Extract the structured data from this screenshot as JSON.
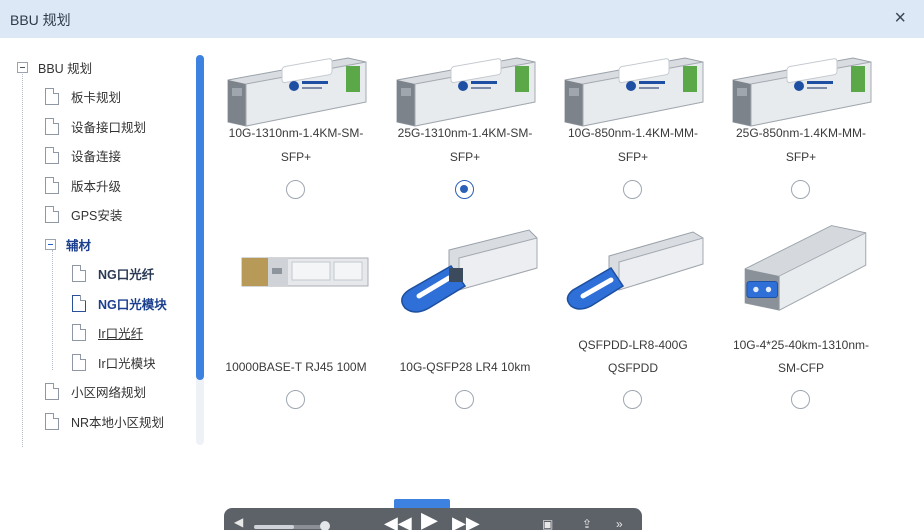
{
  "window": {
    "title": "BBU 规划",
    "close_glyph": "×"
  },
  "tree": {
    "root": "BBU 规划",
    "items": [
      {
        "label": "板卡规划"
      },
      {
        "label": "设备接口规划"
      },
      {
        "label": "设备连接"
      },
      {
        "label": "版本升级"
      },
      {
        "label": "GPS安装"
      }
    ],
    "group": {
      "label": "辅材",
      "children": [
        {
          "label": "NG口光纤"
        },
        {
          "label": "NG口光模块"
        },
        {
          "label": "Ir口光纤"
        },
        {
          "label": "Ir口光模块"
        }
      ]
    },
    "after": [
      {
        "label": "小区网络规划"
      },
      {
        "label": "NR本地小区规划"
      }
    ]
  },
  "modules": [
    {
      "line1": "10G-1310nm-1.4KM-SM-",
      "line2": "SFP+",
      "selected": false,
      "icon": "sfp-module-icon"
    },
    {
      "line1": "25G-1310nm-1.4KM-SM-",
      "line2": "SFP+",
      "selected": true,
      "icon": "sfp-module-icon"
    },
    {
      "line1": "10G-850nm-1.4KM-MM-",
      "line2": "SFP+",
      "selected": false,
      "icon": "sfp-module-icon"
    },
    {
      "line1": "25G-850nm-1.4KM-MM-",
      "line2": "SFP+",
      "selected": false,
      "icon": "sfp-module-icon"
    },
    {
      "line1": "10000BASE-T RJ45 100M",
      "line2": "",
      "selected": false,
      "icon": "rj45-module-icon"
    },
    {
      "line1": "10G-QSFP28 LR4 10km",
      "line2": "",
      "selected": false,
      "icon": "qsfp28-module-icon"
    },
    {
      "line1": "QSFPDD-LR8-400G",
      "line2": "QSFPDD",
      "selected": false,
      "icon": "qsfpdd-module-icon"
    },
    {
      "line1": "10G-4*25-40km-1310nm-",
      "line2": "SM-CFP",
      "selected": false,
      "icon": "cfp-module-icon"
    }
  ],
  "colors": {
    "accent": "#2b5fb8",
    "scrollbar": "#3d82e0",
    "titlebar": "#dde8f6"
  },
  "player": {
    "volume_icon": "speaker-icon",
    "rewind_icon": "rewind-icon",
    "play_icon": "play-icon",
    "forward_icon": "fast-forward-icon",
    "pip_icon": "picture-in-picture-icon",
    "share_icon": "share-icon",
    "more_icon": "more-icon"
  }
}
